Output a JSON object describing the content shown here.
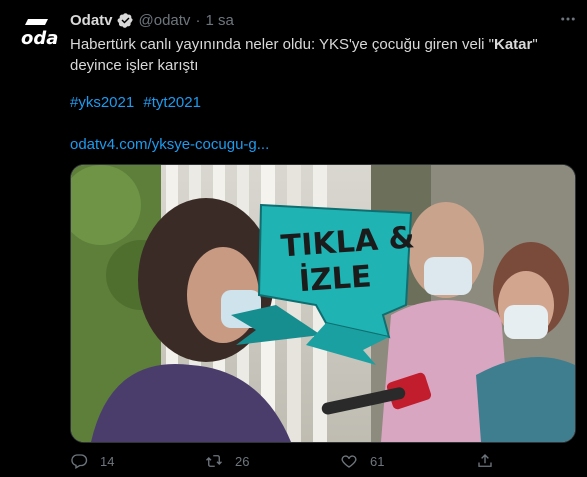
{
  "tweet": {
    "author_name": "Odatv",
    "verified_icon": "verified-badge-icon",
    "handle": "@odatv",
    "separator": "·",
    "time": "1 sa",
    "text_part1": "Habertürk canlı yayınında neler oldu: YKS'ye çocuğu giren veli \"",
    "text_bold": "Katar",
    "text_part2": "\" deyince işler karıştı",
    "hashtags": [
      "#yks2021",
      "#tyt2021"
    ],
    "link": "odatv4.com/yksye-cocugu-g...",
    "avatar_text": "oda",
    "media_overlay_line1": "TIKLA &",
    "media_overlay_line2": "İZLE"
  },
  "actions": {
    "reply_count": "14",
    "retweet_count": "26",
    "like_count": "61"
  },
  "colors": {
    "background": "#000000",
    "text": "#d9d9d9",
    "muted": "#6e767d",
    "link": "#1d9bf0",
    "overlay": "#1fb3b3"
  }
}
